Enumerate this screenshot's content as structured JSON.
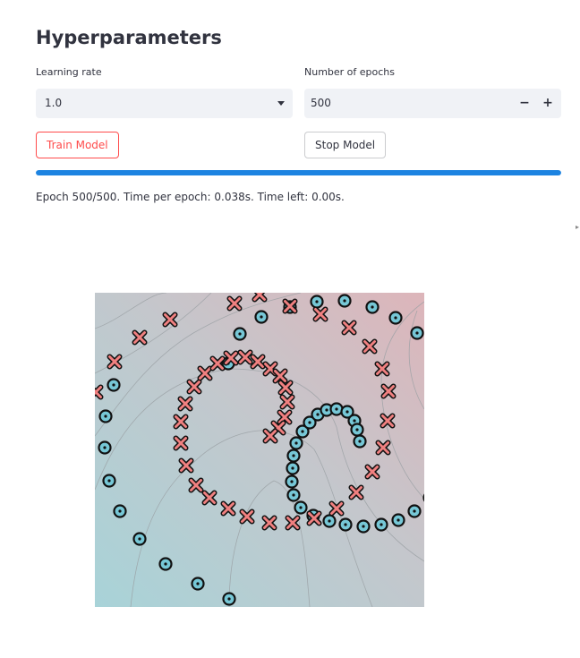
{
  "header": {
    "title": "Hyperparameters"
  },
  "learning_rate": {
    "label": "Learning rate",
    "value": "1.0"
  },
  "epochs": {
    "label": "Number of epochs",
    "value": "500",
    "minus": "−",
    "plus": "+"
  },
  "buttons": {
    "train": "Train Model",
    "stop": "Stop Model"
  },
  "progress": {
    "fraction": 1.0,
    "color": "#1c83e1"
  },
  "status_text": "Epoch 500/500. Time per epoch: 0.038s. Time left: 0.00s.",
  "chart_data": {
    "type": "scatter",
    "title": "",
    "xlabel": "",
    "ylabel": "",
    "grid": false,
    "background": "decision-boundary contour, teal (lower-left) to pink (upper-right)",
    "colors": {
      "class_o": "#76c7d6",
      "class_x": "#f08080",
      "low": "#a8d3d8",
      "high": "#ddb5ba"
    },
    "series": [
      {
        "marker": "circle-dot",
        "points": [
          [
            149,
            406
          ],
          [
            162,
            373
          ],
          [
            186,
            354
          ],
          [
            218,
            343
          ],
          [
            248,
            337
          ],
          [
            279,
            336
          ],
          [
            310,
            343
          ],
          [
            336,
            355
          ],
          [
            360,
            372
          ],
          [
            378,
            393
          ],
          [
            391,
            415
          ],
          [
            397,
            438
          ],
          [
            400,
            462
          ],
          [
            398,
            489
          ],
          [
            395,
            514
          ],
          [
            387,
            538
          ],
          [
            374,
            556
          ],
          [
            357,
            571
          ],
          [
            339,
            581
          ],
          [
            320,
            586
          ],
          [
            300,
            588
          ],
          [
            280,
            586
          ],
          [
            262,
            582
          ],
          [
            244,
            576
          ],
          [
            230,
            567
          ],
          [
            222,
            553
          ],
          [
            220,
            538
          ],
          [
            221,
            523
          ],
          [
            222,
            509
          ],
          [
            225,
            495
          ],
          [
            232,
            482
          ],
          [
            240,
            472
          ],
          [
            249,
            463
          ],
          [
            259,
            458
          ],
          [
            270,
            457
          ],
          [
            282,
            460
          ],
          [
            290,
            470
          ],
          [
            293,
            480
          ],
          [
            296,
            493
          ],
          [
            21,
            430
          ],
          [
            12,
            465
          ],
          [
            11,
            500
          ],
          [
            16,
            537
          ],
          [
            28,
            571
          ],
          [
            50,
            602
          ],
          [
            79,
            630
          ],
          [
            115,
            652
          ],
          [
            150,
            669
          ]
        ]
      },
      {
        "marker": "x",
        "points": [
          [
            156,
            339
          ],
          [
            184,
            329
          ],
          [
            218,
            342
          ],
          [
            252,
            351
          ],
          [
            284,
            366
          ],
          [
            307,
            387
          ],
          [
            321,
            412
          ],
          [
            328,
            437
          ],
          [
            327,
            470
          ],
          [
            322,
            500
          ],
          [
            310,
            527
          ],
          [
            292,
            550
          ],
          [
            270,
            568
          ],
          [
            245,
            579
          ],
          [
            221,
            584
          ],
          [
            195,
            584
          ],
          [
            170,
            577
          ],
          [
            149,
            568
          ],
          [
            128,
            556
          ],
          [
            113,
            542
          ],
          [
            102,
            520
          ],
          [
            96,
            495
          ],
          [
            96,
            471
          ],
          [
            101,
            451
          ],
          [
            111,
            432
          ],
          [
            123,
            417
          ],
          [
            137,
            406
          ],
          [
            152,
            400
          ],
          [
            168,
            399
          ],
          [
            182,
            404
          ],
          [
            196,
            412
          ],
          [
            207,
            420
          ],
          [
            213,
            433
          ],
          [
            215,
            449
          ],
          [
            212,
            466
          ],
          [
            205,
            478
          ],
          [
            196,
            487
          ],
          [
            84,
            357
          ],
          [
            50,
            377
          ],
          [
            22,
            404
          ],
          [
            1,
            438
          ]
        ]
      }
    ]
  }
}
